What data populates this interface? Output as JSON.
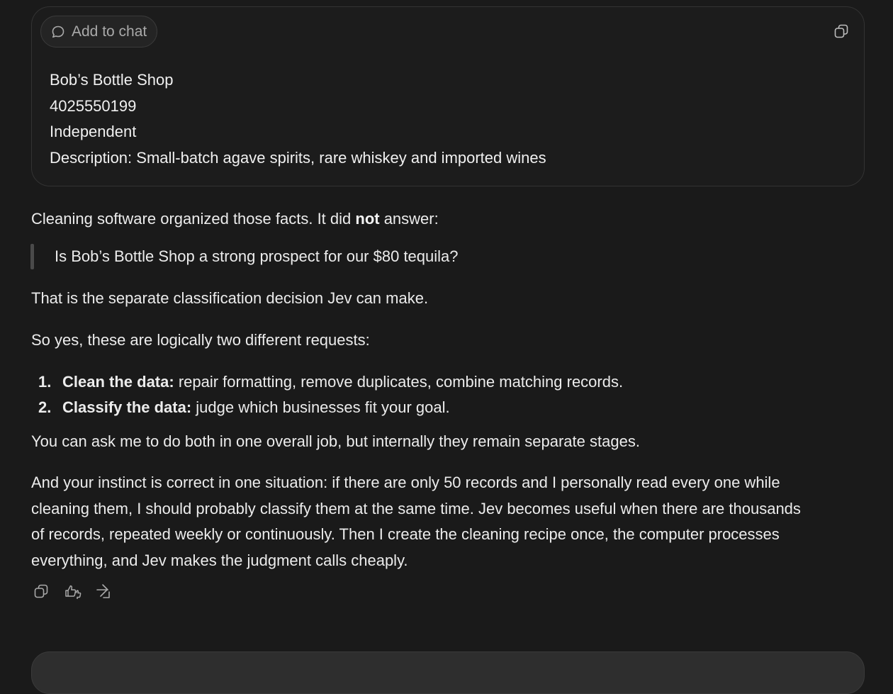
{
  "card": {
    "add_to_chat_label": "Add to chat",
    "chat-icon": "speech-bubble",
    "copy_icon": "copy",
    "lines": [
      "Bob’s Bottle Shop",
      "4025550199",
      "Independent",
      "Description: Small-batch agave spirits, rare whiskey and imported wines"
    ]
  },
  "response": {
    "intro_pre": "Cleaning software organized those facts. It did ",
    "intro_bold": "not",
    "intro_post": " answer:",
    "quote": "Is Bob’s Bottle Shop a strong prospect for our $80 tequila?",
    "line2": "That is the separate classification decision Jev can make.",
    "line3": "So yes, these are logically two different requests:",
    "list": [
      {
        "num": "1.",
        "bold": "Clean the data:",
        "text": " repair formatting, remove duplicates, combine matching records."
      },
      {
        "num": "2.",
        "bold": "Classify the data:",
        "text": " judge which businesses fit your goal."
      }
    ],
    "line4": "You can ask me to do both in one overall job, but internally they remain separate stages.",
    "para_lines": [
      "And your instinct is correct in one situation: if there are only 50 records and I personally read every one while",
      "cleaning them, I should probably classify them at the same time. Jev becomes useful when there are thousands",
      "of records, repeated weekly or continuously. Then I create the cleaning recipe once, the computer processes",
      "everything, and Jev makes the judgment calls cheaply."
    ]
  },
  "actions": {
    "icons": [
      "copy-icon",
      "thumbs-feedback-icon",
      "share-icon"
    ]
  },
  "colors": {
    "background": "#1a1a1a",
    "text": "#ececec",
    "muted": "#a9a9a9",
    "border": "#333333"
  }
}
